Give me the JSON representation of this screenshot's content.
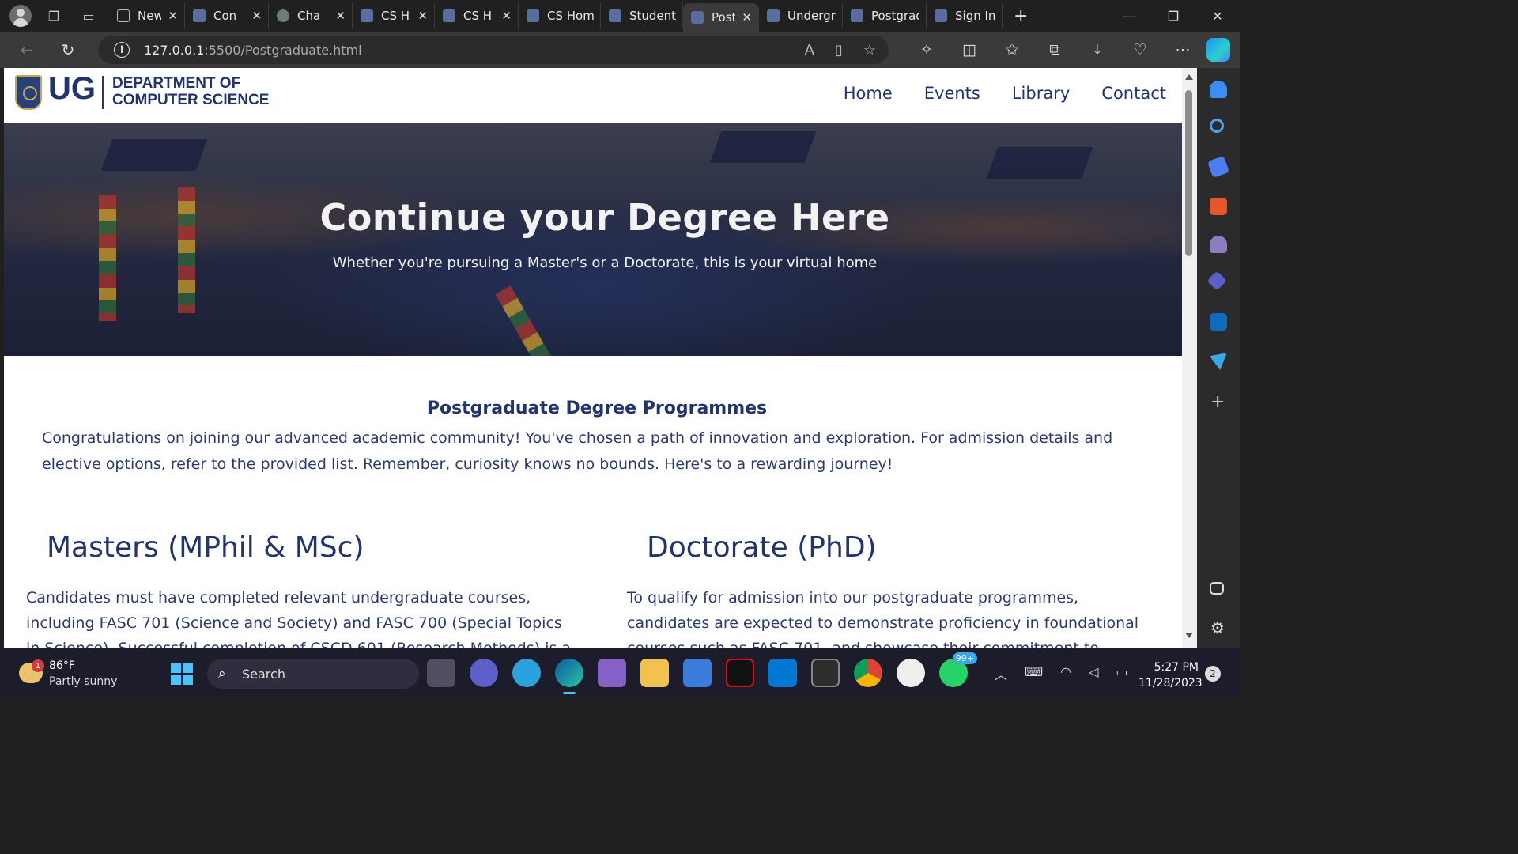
{
  "browser": {
    "tabs": [
      {
        "label": "New",
        "favicon": "page-icon",
        "active": false
      },
      {
        "label": "Con",
        "favicon": "ug-crest-icon",
        "active": false
      },
      {
        "label": "Cha",
        "favicon": "chatgpt-icon",
        "active": false
      },
      {
        "label": "CS H",
        "favicon": "ug-crest-icon",
        "active": false
      },
      {
        "label": "CS H",
        "favicon": "ug-crest-icon",
        "active": false
      },
      {
        "label": "CS Home",
        "favicon": "ug-crest-icon",
        "active": false
      },
      {
        "label": "Students",
        "favicon": "ug-crest-icon",
        "active": false
      },
      {
        "label": "Postg",
        "favicon": "ug-crest-icon",
        "active": true
      },
      {
        "label": "Undergra",
        "favicon": "ug-crest-icon",
        "active": false
      },
      {
        "label": "Postgrad",
        "favicon": "ug-crest-icon",
        "active": false
      },
      {
        "label": "Sign In",
        "favicon": "ug-crest-icon",
        "active": false
      }
    ],
    "close_glyph": "✕",
    "new_tab_glyph": "+",
    "url_host": "127.0.0.1",
    "url_path": ":5500/Postgraduate.html"
  },
  "site": {
    "logo_text": "UG",
    "dept_line1": "DEPARTMENT OF",
    "dept_line2": "COMPUTER SCIENCE",
    "nav": [
      "Home",
      "Events",
      "Library",
      "Contact"
    ],
    "hero_title": "Continue your Degree Here",
    "hero_subtitle": "Whether you're pursuing a Master's or a Doctorate, this is your virtual home",
    "section_title": "Postgraduate Degree Programmes",
    "section_intro": "Congratulations on joining our advanced academic community! You've chosen a path of innovation and exploration. For admission details and elective options, refer to the provided list. Remember, curiosity knows no bounds. Here's to a rewarding journey!",
    "masters_heading": "Masters (MPhil & MSc)",
    "masters_text": "Candidates must have completed relevant undergraduate courses, including FASC 701 (Science and Society) and FASC 700 (Special Topics in Science). Successful completion of CSCD 601 (Research Methods) is a",
    "phd_heading": "Doctorate (PhD)",
    "phd_text": "To qualify for admission into our postgraduate programmes, candidates are expected to demonstrate proficiency in foundational courses such as FASC 701, and showcase their commitment to"
  },
  "taskbar": {
    "weather_temp": "86°F",
    "weather_cond": "Partly sunny",
    "weather_badge": "1",
    "search_label": "Search",
    "whatsapp_badge": "99+",
    "time": "5:27 PM",
    "date": "11/28/2023",
    "notifications": "2"
  },
  "colors": {
    "brand_navy": "#22346e",
    "text_navy": "#2a3a6c",
    "accent_blue": "#4cc2ff"
  }
}
